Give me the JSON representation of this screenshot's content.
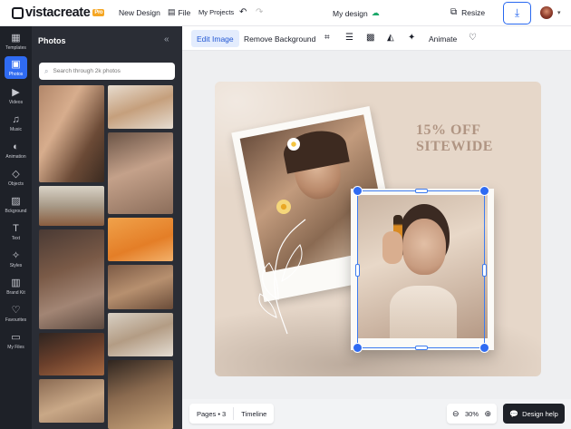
{
  "topbar": {
    "brand": "vistacreate",
    "pro_badge": "Pro",
    "new_design": "New Design",
    "file": "File",
    "my_projects": "My Projects",
    "doc_title": "My design",
    "resize": "Resize"
  },
  "nav": {
    "items": [
      {
        "label": "Templates",
        "icon": "templates-icon"
      },
      {
        "label": "Photos",
        "icon": "photos-icon"
      },
      {
        "label": "Videos",
        "icon": "videos-icon"
      },
      {
        "label": "Music",
        "icon": "music-icon"
      },
      {
        "label": "Animation",
        "icon": "animation-icon"
      },
      {
        "label": "Objects",
        "icon": "objects-icon"
      },
      {
        "label": "Bckground",
        "icon": "background-icon"
      },
      {
        "label": "Text",
        "icon": "text-icon"
      },
      {
        "label": "Styles",
        "icon": "styles-icon"
      },
      {
        "label": "Brand Kit",
        "icon": "brand-kit-icon"
      },
      {
        "label": "Favourites",
        "icon": "heart-icon"
      },
      {
        "label": "My Files",
        "icon": "folder-icon"
      }
    ],
    "active": "Photos"
  },
  "panel": {
    "title": "Photos",
    "search_placeholder": "Search through 2k photos"
  },
  "subtoolbar": {
    "edit_image": "Edit Image",
    "remove_background": "Remove Background",
    "animate": "Animate"
  },
  "poster": {
    "promo_line1": "15% OFF",
    "promo_line2": "SITEWIDE"
  },
  "bottombar": {
    "pages": "Pages • 3",
    "timeline": "Timeline",
    "zoom": "30%",
    "design_help": "Design help"
  },
  "colors": {
    "accent": "#2f6bf2",
    "nav_bg": "#1e2128",
    "panel_bg": "#2a2d35",
    "poster_bg": "#e6d7c9",
    "promo_text": "#b09583"
  }
}
